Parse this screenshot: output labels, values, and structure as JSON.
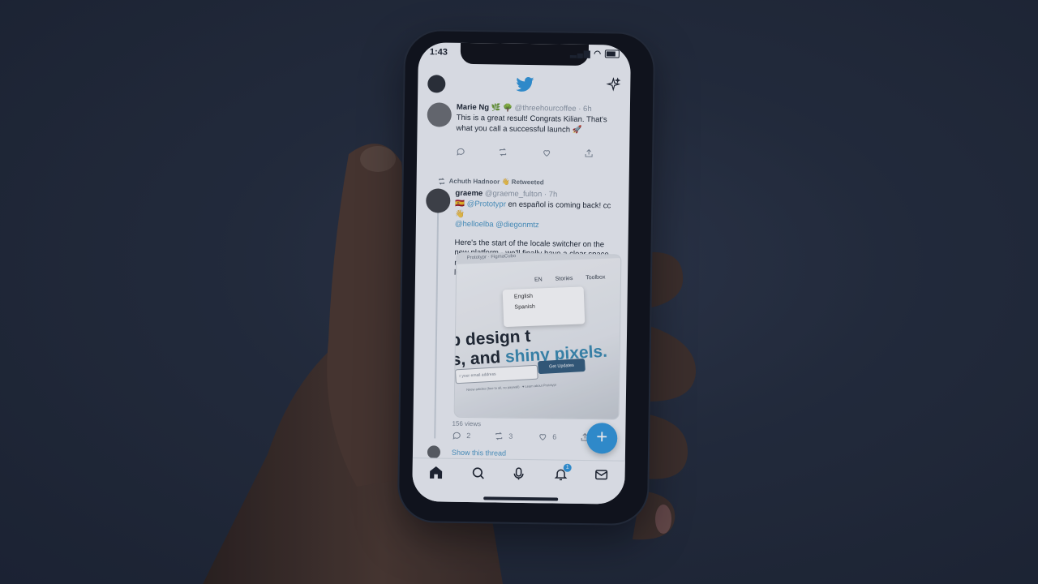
{
  "status_bar": {
    "time": "1:43"
  },
  "icons": {
    "twitter_logo": "twitter-bird-icon",
    "sparkle": "sparkle-icon",
    "reply": "comment-icon",
    "retweet": "retweet-icon",
    "like": "heart-icon",
    "share": "share-icon",
    "compose": "plus-icon"
  },
  "colors": {
    "brand": "#1d9bf0",
    "link": "#3b9ad4",
    "background": "#222a39",
    "skin": "#3b2c25"
  },
  "tweets": [
    {
      "name": "Marie Ng",
      "handle": "@threehourcoffee",
      "age": "· 6h",
      "text": "This is a great result! Congrats Kilian. That's what you call a successful launch 🚀"
    },
    {
      "retweeted_by": "Achuth Hadnoor 👋 Retweeted",
      "name": "graeme",
      "handle": "@graeme_fulton",
      "age": "· 7h",
      "mentions_line1": "@Prototypr",
      "text_line1": " en español is coming back! cc 👋",
      "mentions_line2": "@helloelba @diegonmtz",
      "text_body": "Here's the start of the locale switcher on the new platform - we'll finally have a clear space made for Spanish readers 🎉 , where it can't get lost amongst all the English",
      "views": "156 views",
      "reply_count": "2",
      "retweet_count": "3",
      "like_count": "6"
    }
  ],
  "media": {
    "tabs": "Prototypr  ·  FigmaCubo",
    "nav_lang": "EN",
    "nav_stories": "Stories",
    "nav_toolbox": "Toolbox",
    "menu_options": [
      "English",
      "Spanish"
    ],
    "headline_line1": "p design t",
    "headline_line2a": "s, and ",
    "headline_line2b": "shiny pixels.",
    "input_placeholder": "r your email address",
    "button": "Get Updates",
    "fine_print": "Nnew articles (free to all, no paywall) · ♥ Learn about Prototypr"
  },
  "show_thread": "Show this thread",
  "notifications_badge": "1"
}
